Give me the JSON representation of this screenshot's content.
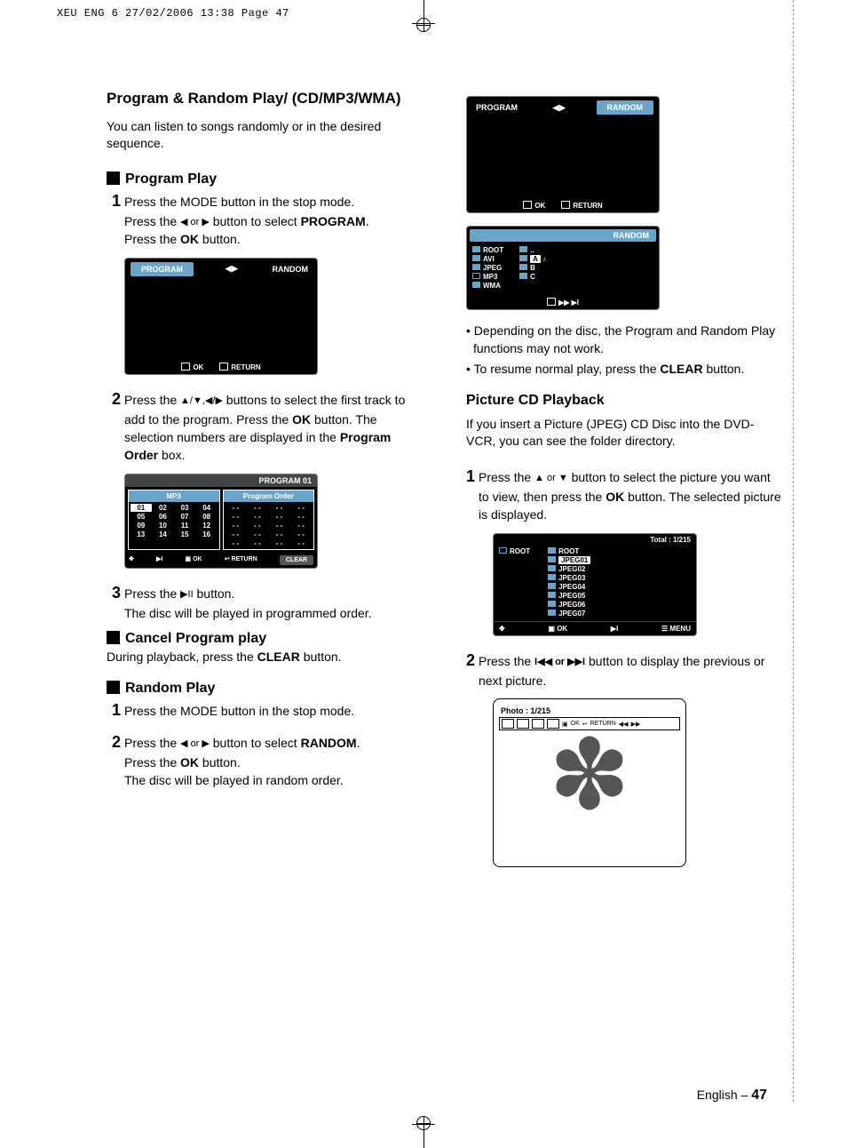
{
  "crop_header": "XEU ENG 6   27/02/2006  13:38  Page 47",
  "title": "Program & Random Play/ (CD/MP3/WMA)",
  "intro": "You can listen to songs randomly or in the desired sequence.",
  "section_program": "Program Play",
  "step1_a": "Press the MODE button in the stop mode.",
  "step1_b_pre": "Press the ",
  "step1_b_post": " button to select ",
  "prog_word": "PROGRAM",
  "step1_c_pre": "Press the ",
  "ok_word": "OK",
  "step1_c_post": " button.",
  "osd1": {
    "left": "PROGRAM",
    "right": "RANDOM",
    "ok": "OK",
    "ret": "RETURN"
  },
  "step2_pre": "Press the ",
  "step2_mid": " buttons to select the first track to add to the program. Press the ",
  "step2_post": " button. The selection numbers are displayed in the ",
  "prog_order": "Program Order",
  "step2_end": " box.",
  "osd2": {
    "title": "PROGRAM  01",
    "left": "MP3",
    "right": "Program Order",
    "grid": [
      "01",
      "02",
      "03",
      "04",
      "05",
      "06",
      "07",
      "08",
      "09",
      "10",
      "11",
      "12",
      "13",
      "14",
      "15",
      "16"
    ],
    "dash": "- -",
    "ok": "OK",
    "ret": "RETURN",
    "clear": "CLEAR"
  },
  "step3_pre": "Press the ",
  "step3_post": " button.",
  "step3_line2": "The disc will be played in programmed order.",
  "section_cancel": "Cancel Program play",
  "cancel_pre": "During playback, press the ",
  "clear_word": "CLEAR",
  "cancel_post": " button.",
  "section_random": "Random Play",
  "r_step1": "Press the MODE button in the stop mode.",
  "r_step2_pre": "Press the ",
  "r_step2_post": " button to select ",
  "random_word": "RANDOM",
  "r_step2_c_pre": "Press the ",
  "r_step2_c_post": " button.",
  "r_step2_line3": "The disc will be played in random order.",
  "osd3": {
    "hdr": "RANDOM",
    "left": [
      "ROOT",
      "AVI",
      "JPEG",
      "MP3",
      "WMA"
    ],
    "right_top": "..",
    "right": [
      "A",
      "B",
      "C"
    ]
  },
  "note1": "Depending on the disc, the Program and Random Play functions may not work.",
  "note2_pre": "To resume normal play, press the ",
  "note2_post": " button.",
  "pic_title": "Picture CD Playback",
  "pic_intro": "If you insert a Picture (JPEG) CD Disc into the DVD-VCR, you can see the folder directory.",
  "pic_s1_pre": "Press the ",
  "pic_s1_mid": " button to select the picture you want to view, then press the ",
  "pic_s1_post": " button. The selected picture is displayed.",
  "osd4": {
    "total": "Total : 1/215",
    "left": "ROOT",
    "right": [
      "ROOT",
      "JPEG01",
      "JPEG02",
      "JPEG03",
      "JPEG04",
      "JPEG05",
      "JPEG06",
      "JPEG07"
    ],
    "ok": "OK",
    "menu": "MENU"
  },
  "pic_s2_pre": "Press the ",
  "pic_s2_post": " button to display the previous or next picture.",
  "photo": {
    "hdr": "Photo : 1/215",
    "ok": "OK",
    "ret": "RETURN"
  },
  "footer_lang": "English",
  "footer_dash": "–",
  "footer_page": "47",
  "arrows": {
    "lr": "◀ or ▶",
    "ud": "▲ or ▼",
    "udlr": "▲/▼,◀/▶",
    "play": "▶II",
    "prevnext": "I◀◀ or ▶▶I",
    "lr_small": "◀ ▶",
    "ffrew": "▶▶  ▶I"
  }
}
